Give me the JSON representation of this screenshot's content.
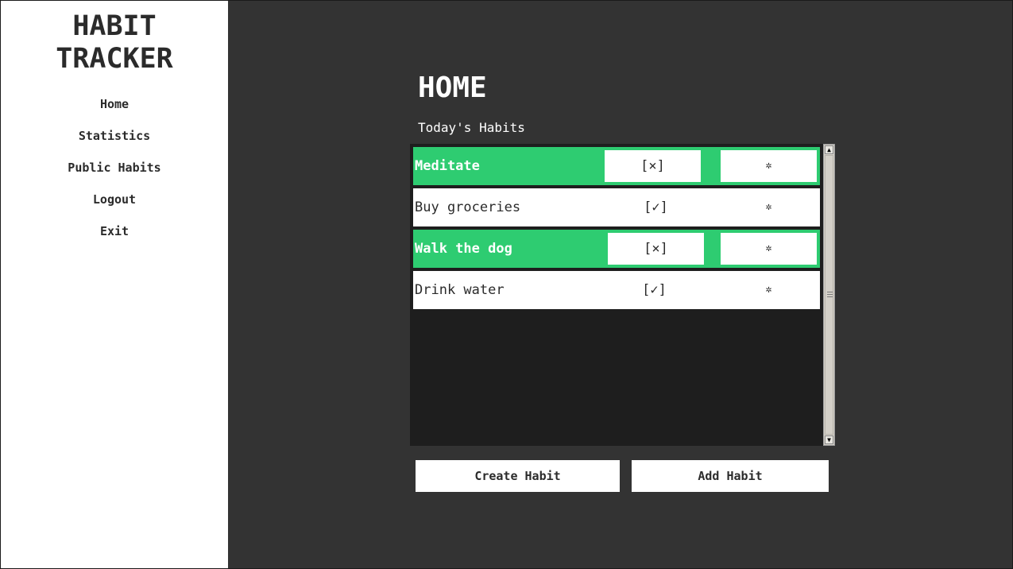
{
  "sidebar": {
    "title_line1": "HABIT",
    "title_line2": "TRACKER",
    "nav": [
      {
        "label": "Home"
      },
      {
        "label": "Statistics"
      },
      {
        "label": "Public Habits"
      },
      {
        "label": "Logout"
      },
      {
        "label": "Exit"
      }
    ]
  },
  "main": {
    "title": "HOME",
    "subtitle": "Today's Habits",
    "habits": [
      {
        "name": "Meditate",
        "toggle": "[×]",
        "settings_icon": "gear-icon",
        "settings_glyph": "✲",
        "completed": true
      },
      {
        "name": "Buy groceries",
        "toggle": "[✓]",
        "settings_icon": "gear-icon",
        "settings_glyph": "✲",
        "completed": false
      },
      {
        "name": "Walk the dog",
        "toggle": "[×]",
        "settings_icon": "gear-icon",
        "settings_glyph": "✲",
        "completed": true
      },
      {
        "name": "Drink water",
        "toggle": "[✓]",
        "settings_icon": "gear-icon",
        "settings_glyph": "✲",
        "completed": false
      }
    ],
    "buttons": {
      "create": "Create Habit",
      "add": "Add Habit"
    }
  },
  "colors": {
    "background": "#333333",
    "sidebar": "#ffffff",
    "list_background": "#1e1e1e",
    "completed": "#2ecc71",
    "text": "#2b2b2b"
  }
}
